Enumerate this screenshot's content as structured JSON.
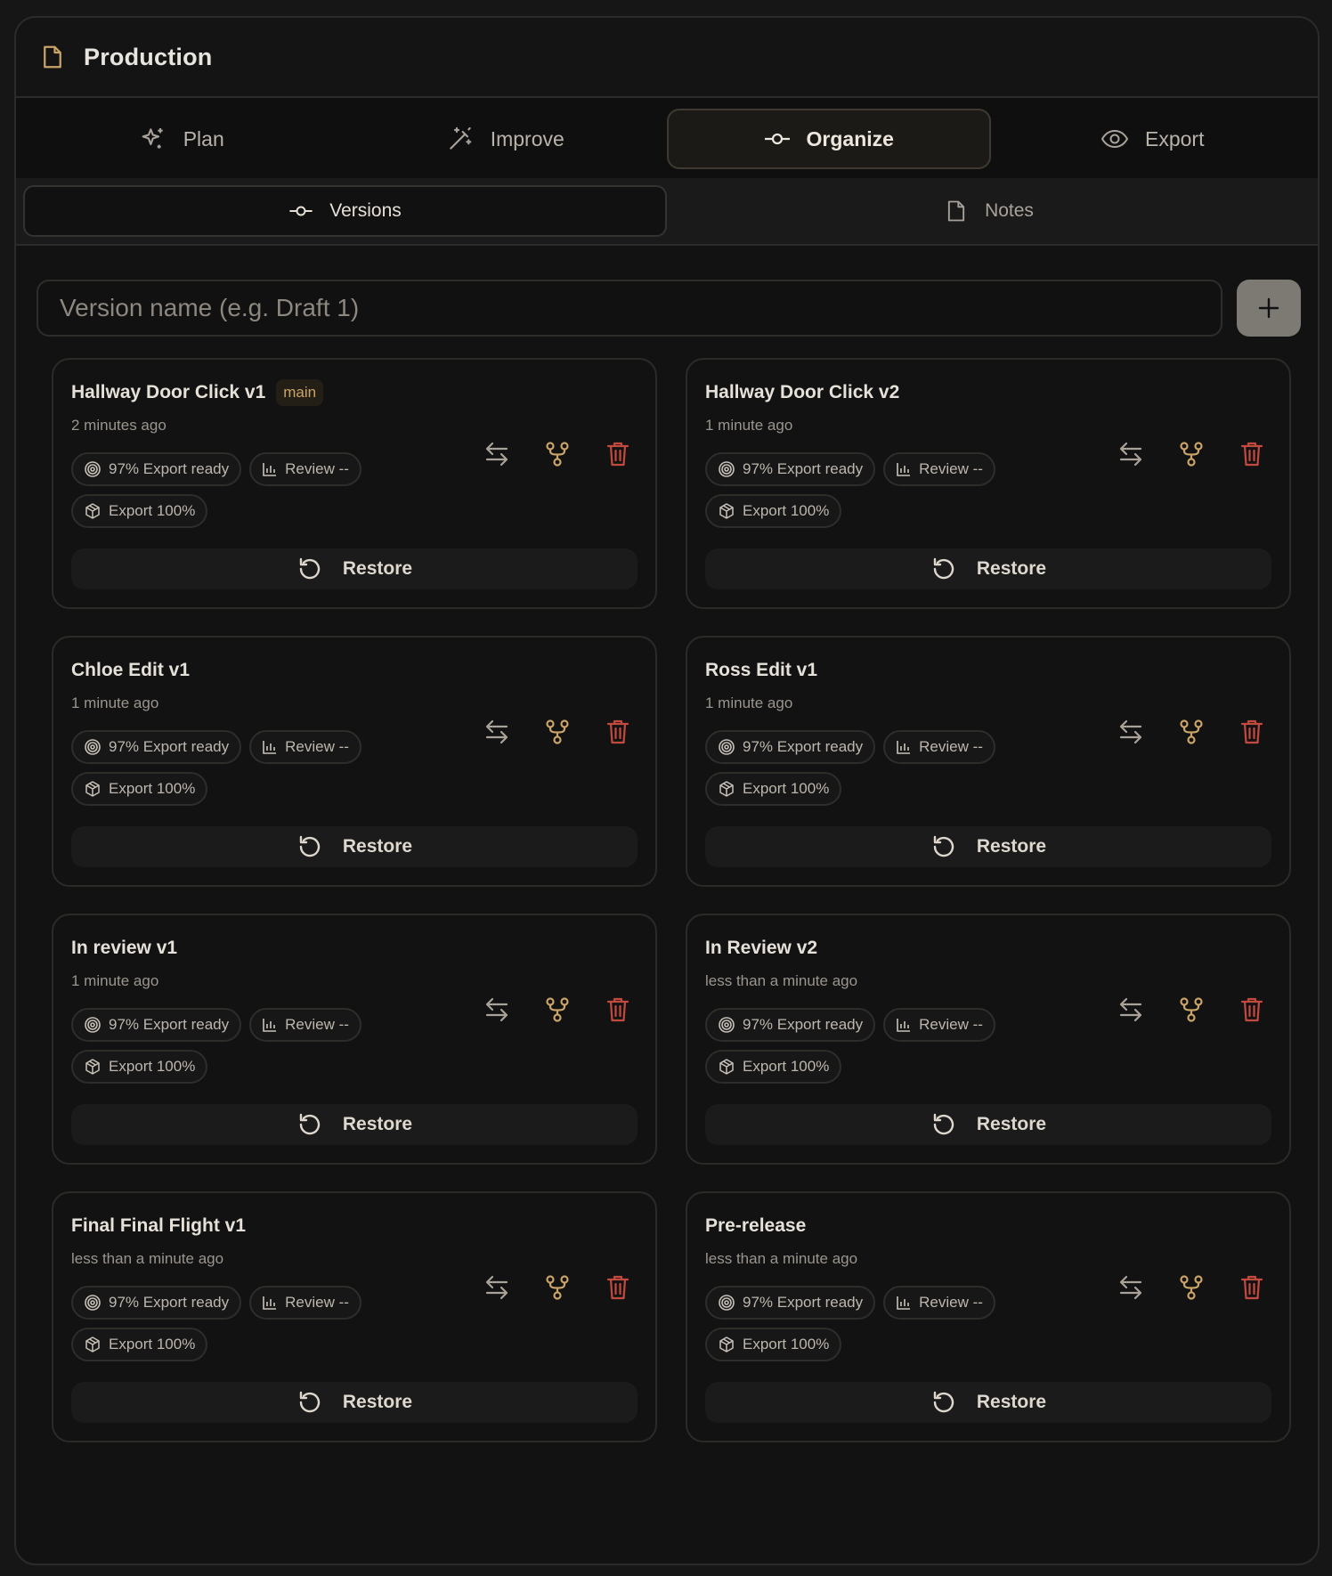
{
  "header": {
    "title": "Production",
    "icon": "file-icon"
  },
  "tabs": [
    {
      "label": "Plan",
      "icon": "sparkles-icon",
      "active": false
    },
    {
      "label": "Improve",
      "icon": "magic-wand-icon",
      "active": false
    },
    {
      "label": "Organize",
      "icon": "git-commit-icon",
      "active": true
    },
    {
      "label": "Export",
      "icon": "eye-icon",
      "active": false
    }
  ],
  "subtabs": [
    {
      "label": "Versions",
      "icon": "git-commit-icon",
      "active": true
    },
    {
      "label": "Notes",
      "icon": "file-icon",
      "active": false
    }
  ],
  "new_version": {
    "placeholder": "Version name (e.g. Draft 1)",
    "value": ""
  },
  "colors": {
    "accent": "#c9a368",
    "danger": "#c24a3f",
    "muted": "#9a958d"
  },
  "versions": [
    {
      "name": "Hallway Door Click v1",
      "badge": "main",
      "time": "2 minutes ago",
      "export_ready": "97% Export ready",
      "review": "Review --",
      "export": "Export 100%",
      "restore": "Restore"
    },
    {
      "name": "Hallway Door Click v2",
      "badge": "",
      "time": "1 minute ago",
      "export_ready": "97% Export ready",
      "review": "Review --",
      "export": "Export 100%",
      "restore": "Restore"
    },
    {
      "name": "Chloe Edit v1",
      "badge": "",
      "time": "1 minute ago",
      "export_ready": "97% Export ready",
      "review": "Review --",
      "export": "Export 100%",
      "restore": "Restore"
    },
    {
      "name": "Ross Edit v1",
      "badge": "",
      "time": "1 minute ago",
      "export_ready": "97% Export ready",
      "review": "Review --",
      "export": "Export 100%",
      "restore": "Restore"
    },
    {
      "name": "In review v1",
      "badge": "",
      "time": "1 minute ago",
      "export_ready": "97% Export ready",
      "review": "Review --",
      "export": "Export 100%",
      "restore": "Restore"
    },
    {
      "name": "In Review v2",
      "badge": "",
      "time": "less than a minute ago",
      "export_ready": "97% Export ready",
      "review": "Review --",
      "export": "Export 100%",
      "restore": "Restore"
    },
    {
      "name": "Final Final Flight v1",
      "badge": "",
      "time": "less than a minute ago",
      "export_ready": "97% Export ready",
      "review": "Review --",
      "export": "Export 100%",
      "restore": "Restore"
    },
    {
      "name": "Pre-release",
      "badge": "",
      "time": "less than a minute ago",
      "export_ready": "97% Export ready",
      "review": "Review --",
      "export": "Export 100%",
      "restore": "Restore"
    }
  ]
}
